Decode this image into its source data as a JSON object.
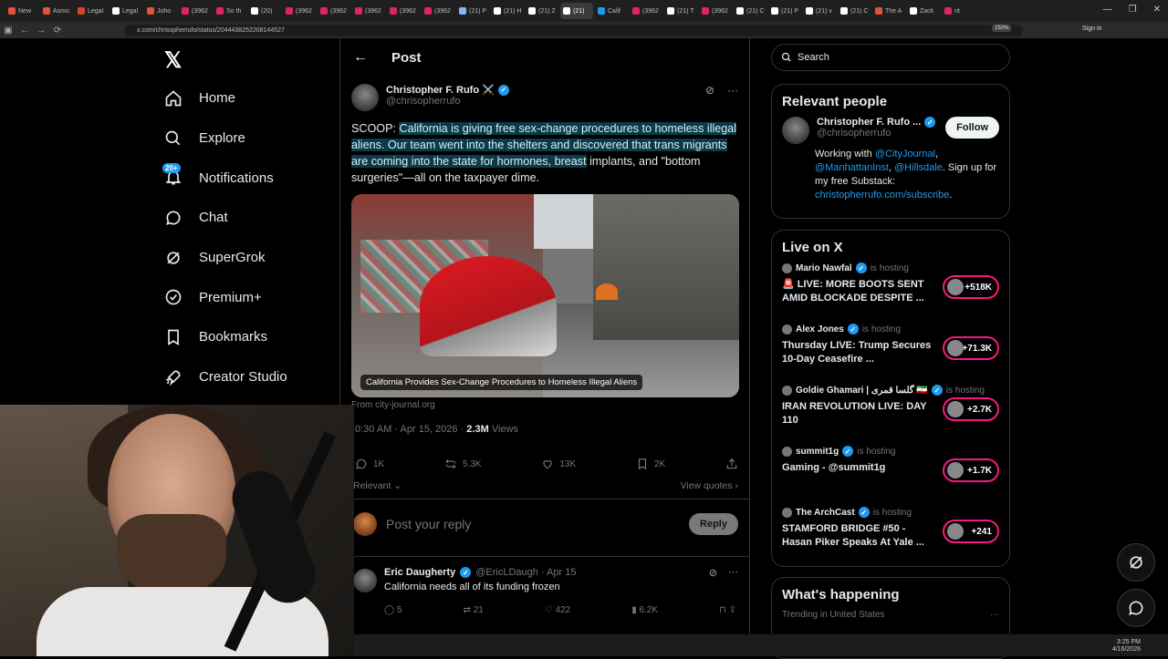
{
  "browser": {
    "tabs": [
      {
        "label": "New",
        "color": "#e0533a"
      },
      {
        "label": "Asmo",
        "color": "#e0533a"
      },
      {
        "label": "Legal",
        "color": "#d9432f"
      },
      {
        "label": "Legal",
        "color": "#ffffff"
      },
      {
        "label": "Joho",
        "color": "#e0533a"
      },
      {
        "label": "(3962",
        "color": "#e0245e"
      },
      {
        "label": "So th",
        "color": "#e0245e"
      },
      {
        "label": "(20)",
        "color": "#ffffff"
      },
      {
        "label": "(3962",
        "color": "#e0245e"
      },
      {
        "label": "(3962",
        "color": "#e0245e"
      },
      {
        "label": "(3962",
        "color": "#e0245e"
      },
      {
        "label": "(3962",
        "color": "#e0245e"
      },
      {
        "label": "(3962",
        "color": "#e0245e"
      },
      {
        "label": "(21) P",
        "color": "#8ab4f8"
      },
      {
        "label": "(21) H",
        "color": "#ffffff"
      },
      {
        "label": "(21) Z",
        "color": "#ffffff"
      },
      {
        "label": "(21)",
        "color": "#ffffff"
      },
      {
        "label": "Calif",
        "color": "#1d9bf0"
      },
      {
        "label": "(3962",
        "color": "#e0245e"
      },
      {
        "label": "(21) T",
        "color": "#ffffff"
      },
      {
        "label": "(3962",
        "color": "#e0245e"
      },
      {
        "label": "(21) C",
        "color": "#ffffff"
      },
      {
        "label": "(21) P",
        "color": "#ffffff"
      },
      {
        "label": "(21) v",
        "color": "#ffffff"
      },
      {
        "label": "(21) C",
        "color": "#ffffff"
      },
      {
        "label": "The A",
        "color": "#e0533a"
      },
      {
        "label": "Zack",
        "color": "#ffffff"
      },
      {
        "label": "rit",
        "color": "#e0245e"
      }
    ],
    "active_tab_index": 16,
    "url": "x.com/chrisopherrufo/status/2044438252208144527",
    "zoom": "150%",
    "signin": "Sign in"
  },
  "sidebar": {
    "items": [
      {
        "label": "Home",
        "icon": "home-icon"
      },
      {
        "label": "Explore",
        "icon": "search-icon"
      },
      {
        "label": "Notifications",
        "icon": "bell-icon",
        "badge": "20+"
      },
      {
        "label": "Chat",
        "icon": "chat-icon"
      },
      {
        "label": "SuperGrok",
        "icon": "grok-icon"
      },
      {
        "label": "Premium+",
        "icon": "premium-icon"
      },
      {
        "label": "Bookmarks",
        "icon": "bookmark-icon"
      },
      {
        "label": "Creator Studio",
        "icon": "rocket-icon"
      }
    ]
  },
  "post": {
    "header_title": "Post",
    "author_name": "Christopher F. Rufo ⚔️",
    "author_handle": "@chrisopherrufo",
    "text_prefix": "SCOOP: ",
    "text_highlight": "California is giving free sex-change procedures to homeless illegal aliens. Our team went into the shelters and discovered that trans migrants are coming into the state for hormones, breast",
    "text_suffix": " implants, and \"bottom surgeries\"—all on the taxpayer dime.",
    "media_caption": "California Provides Sex-Change Procedures to Homeless Illegal Aliens",
    "from": "From city-journal.org",
    "time": "0:30 AM · Apr 15, 2026 · ",
    "views_count": "2.3M",
    "views_label": " Views",
    "stats": {
      "replies": "1K",
      "reposts": "5.3K",
      "likes": "13K",
      "bookmarks": "2K"
    },
    "relevant_label": "Relevant ⌄",
    "view_quotes": "View quotes ›",
    "reply_placeholder": "Post your reply",
    "reply_button": "Reply"
  },
  "reply": {
    "name": "Eric Daugherty",
    "handle": "@EricLDaugh · Apr 15",
    "text": "California needs all of its funding frozen",
    "stats": {
      "replies": "5",
      "reposts": "21",
      "likes": "422",
      "views": "6.2K"
    }
  },
  "search": {
    "placeholder": "Search"
  },
  "relevant_people": {
    "title": "Relevant people",
    "name": "Christopher F. Rufo ...",
    "handle": "@chrisopherrufo",
    "follow": "Follow",
    "bio_1": "Working with ",
    "bio_link1": "@CityJournal",
    "bio_2": ", ",
    "bio_link2": "@ManhattanInst",
    "bio_3": ", ",
    "bio_link3": "@Hillsdale",
    "bio_4": ". Sign up for my free Substack: ",
    "bio_link4": "christopherrufo.com/subscribe",
    "bio_5": "."
  },
  "live": {
    "title": "Live on X",
    "items": [
      {
        "host": "Mario Nawfal",
        "hosting": "is hosting",
        "title": "🚨 LIVE: MORE BOOTS SENT AMID BLOCKADE DESPITE ...",
        "count": "+518K"
      },
      {
        "host": "Alex Jones",
        "hosting": "is hosting",
        "title": "Thursday LIVE: Trump Secures 10-Day Ceasefire ...",
        "count": "+71.3K"
      },
      {
        "host": "Goldie Ghamari | گلسا قمری 🇮🇷",
        "hosting": "is hosting",
        "title": "IRAN REVOLUTION LIVE: DAY 110",
        "count": "+2.7K"
      },
      {
        "host": "summit1g",
        "hosting": "is hosting",
        "title": "Gaming - @summit1g",
        "count": "+1.7K"
      },
      {
        "host": "The ArchCast",
        "hosting": "is hosting",
        "title": "STAMFORD BRIDGE #50 - Hasan Piker Speaks At Yale ...",
        "count": "+241"
      }
    ]
  },
  "happening": {
    "title": "What's happening",
    "subtitle": "Trending in United States",
    "more": "···"
  },
  "taskbar": {
    "time": "3:25 PM",
    "date": "4/16/2026"
  }
}
